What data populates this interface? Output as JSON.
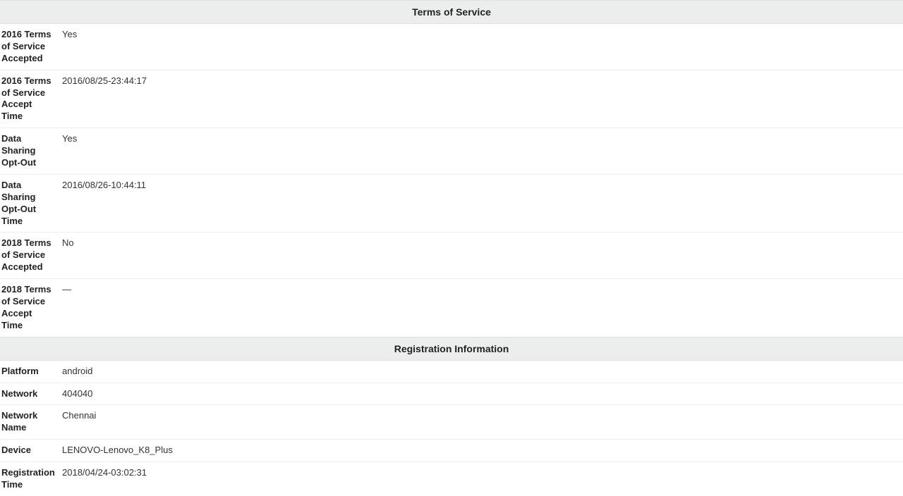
{
  "sections": {
    "tos": {
      "header": "Terms of Service",
      "rows": {
        "tos2016accepted": {
          "label": "2016 Terms of Service Accepted",
          "value": "Yes"
        },
        "tos2016time": {
          "label": "2016 Terms of Service Accept Time",
          "value": "2016/08/25-23:44:17"
        },
        "dsOptOut": {
          "label": "Data Sharing Opt-Out",
          "value": "Yes"
        },
        "dsOptOutTime": {
          "label": "Data Sharing Opt-Out Time",
          "value": "2016/08/26-10:44:11"
        },
        "tos2018accepted": {
          "label": "2018 Terms of Service Accepted",
          "value": "No"
        },
        "tos2018time": {
          "label": "2018 Terms of Service Accept Time",
          "value": "—"
        }
      }
    },
    "reg": {
      "header": "Registration Information",
      "rows": {
        "platform": {
          "label": "Platform",
          "value": "android"
        },
        "network": {
          "label": "Network",
          "value": "404040"
        },
        "networkName": {
          "label": "Network Name",
          "value": "Chennai"
        },
        "device": {
          "label": "Device",
          "value": "LENOVO-Lenovo_K8_Plus"
        },
        "regTime": {
          "label": "Registration Time",
          "value": "2018/04/24-03:02:31"
        }
      }
    }
  }
}
